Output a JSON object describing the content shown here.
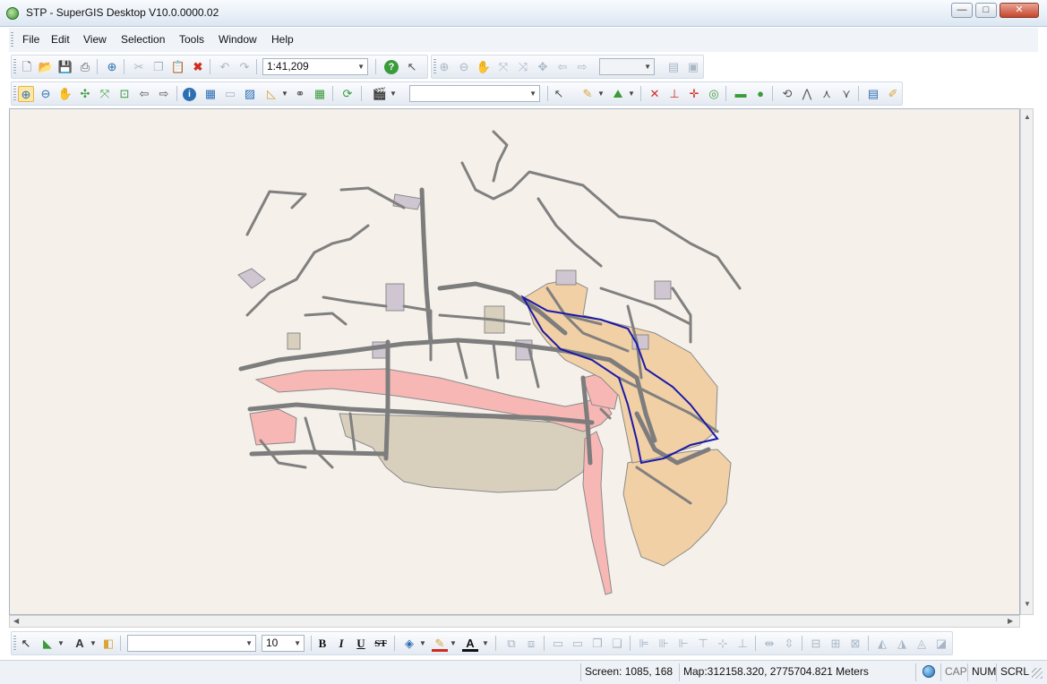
{
  "window": {
    "title": "STP - SuperGIS Desktop V10.0.0000.02",
    "minimize_glyph": "—",
    "maximize_glyph": "□",
    "close_glyph": "✕"
  },
  "menu": {
    "items": [
      "File",
      "Edit",
      "View",
      "Selection",
      "Tools",
      "Window",
      "Help"
    ]
  },
  "standard_toolbar": {
    "scale_value": "1:41,209",
    "icons": [
      "new-document-icon",
      "open-folder-icon",
      "save-icon",
      "print-icon",
      "add-data-icon",
      "cut-icon",
      "copy-icon",
      "paste-icon",
      "delete-icon",
      "undo-icon",
      "redo-icon",
      "help-icon",
      "whats-this-icon"
    ]
  },
  "tools_toolbar": {
    "layer_combo_value": "",
    "icons": [
      "zoom-in-icon",
      "zoom-out-icon",
      "pan-icon",
      "full-extent-icon",
      "fixed-zoom-icon",
      "zoom-to-layer-icon",
      "back-icon",
      "forward-icon",
      "identify-icon",
      "find-icon",
      "measure-icon",
      "hyperlink-icon",
      "refresh-icon",
      "clapperboard-icon"
    ]
  },
  "draw_toolbar": {
    "font_name": "",
    "font_size": "10",
    "bold_label": "B",
    "italic_label": "I",
    "underline_label": "U",
    "strike_label": "ST",
    "text_tool_label": "A",
    "font_color_label": "A"
  },
  "status": {
    "screen": "Screen: 1085, 168",
    "map": "Map:312158.320, 2775704.821 Meters",
    "cap": "CAP",
    "num": "NUM",
    "scrl": "SCRL"
  },
  "colors": {
    "map_background": "#f5f1ea",
    "roads": "#7d7d7d",
    "district_orange": "#f2d0a6",
    "district_pink": "#f7b7b4",
    "district_tan": "#d9cfbd",
    "buildings_lilac": "#cfc6d2",
    "selection_outline": "#1a1aa8"
  }
}
